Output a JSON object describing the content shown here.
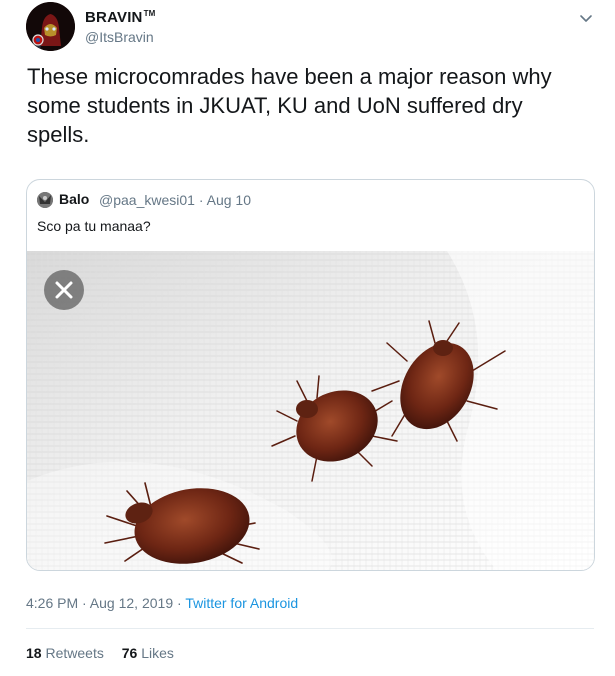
{
  "tweet": {
    "author": {
      "display_name": "BRAVIN",
      "tm_mark": "TM",
      "handle": "@ItsBravin"
    },
    "text": "These microcomrades have been a major reason why some students in JKUAT, KU and UoN suffered dry spells.",
    "quoted": {
      "display_name": "Balo",
      "handle": "@paa_kwesi01",
      "separator": "·",
      "date": "Aug 10",
      "text": "Sco pa tu manaa?",
      "media_icon": "close-icon"
    },
    "timestamp": {
      "time_date": "4:26 PM · Aug 12, 2019",
      "separator": "·",
      "source": "Twitter for Android"
    },
    "stats": {
      "retweets_count": "18",
      "retweets_label": "Retweets",
      "likes_count": "76",
      "likes_label": "Likes"
    },
    "icons": {
      "menu": "chevron-down-icon"
    }
  },
  "colors": {
    "text_primary": "#14171a",
    "text_secondary": "#657786",
    "link": "#1b95e0",
    "border": "#ccd6dd"
  }
}
